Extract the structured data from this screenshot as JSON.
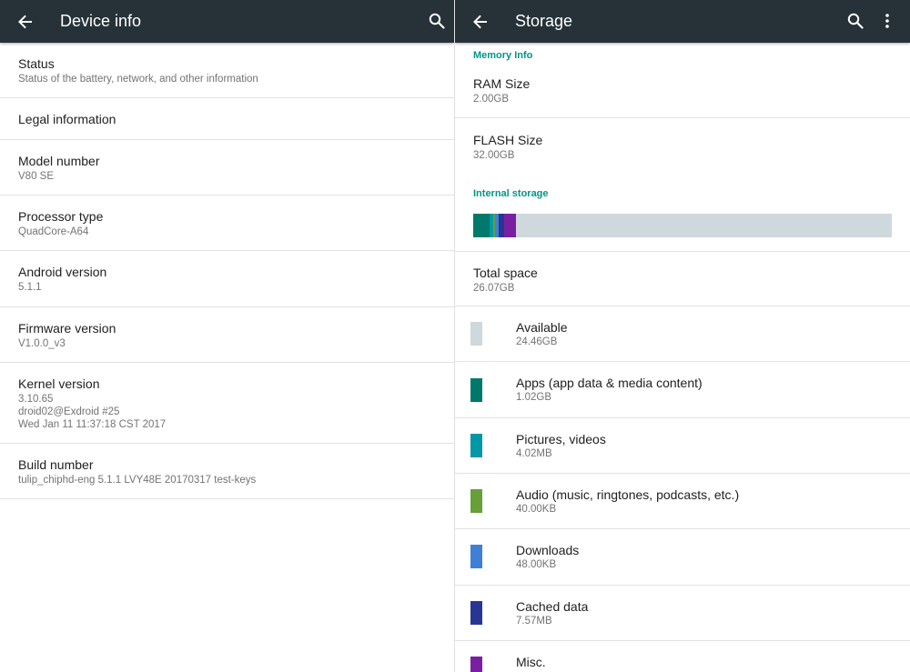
{
  "device_info": {
    "title": "Device info",
    "rows": [
      {
        "title": "Status",
        "subtitle": "Status of the battery, network, and other information"
      },
      {
        "title": "Legal information"
      },
      {
        "title": "Model number",
        "subtitle": "V80 SE"
      },
      {
        "title": "Processor type",
        "subtitle": "QuadCore-A64"
      },
      {
        "title": "Android version",
        "subtitle": "5.1.1"
      },
      {
        "title": "Firmware version",
        "subtitle": "V1.0.0_v3"
      },
      {
        "title": "Kernel version",
        "subtitle_lines": [
          "3.10.65",
          "droid02@Exdroid #25",
          "Wed Jan 11 11:37:18 CST 2017"
        ]
      },
      {
        "title": "Build number",
        "subtitle": "tulip_chiphd-eng 5.1.1 LVY48E 20170317 test-keys"
      }
    ]
  },
  "storage": {
    "title": "Storage",
    "memory_section": "Memory Info",
    "ram": {
      "title": "RAM Size",
      "value": "2.00GB"
    },
    "flash": {
      "title": "FLASH Size",
      "value": "32.00GB"
    },
    "internal_section": "Internal storage",
    "usage_bar": {
      "track_color": "#cfd8dc",
      "segments": [
        {
          "color": "#00796b",
          "fraction": 0.039
        },
        {
          "color": "#0097a7",
          "fraction": 0.008
        },
        {
          "color": "#689f38",
          "fraction": 0.006
        },
        {
          "color": "#3f7fd6",
          "fraction": 0.008
        },
        {
          "color": "#283593",
          "fraction": 0.013
        },
        {
          "color": "#7b1fa2",
          "fraction": 0.028
        }
      ]
    },
    "total": {
      "title": "Total space",
      "value": "26.07GB"
    },
    "items": [
      {
        "label": "Available",
        "value": "24.46GB",
        "color": "#cfd8dc"
      },
      {
        "label": "Apps (app data & media content)",
        "value": "1.02GB",
        "color": "#00796b"
      },
      {
        "label": "Pictures, videos",
        "value": "4.02MB",
        "color": "#0097a7"
      },
      {
        "label": "Audio (music, ringtones, podcasts, etc.)",
        "value": "40.00KB",
        "color": "#689f38"
      },
      {
        "label": "Downloads",
        "value": "48.00KB",
        "color": "#3f7fd6"
      },
      {
        "label": "Cached data",
        "value": "7.57MB",
        "color": "#283593"
      },
      {
        "label": "Misc.",
        "color": "#7b1fa2"
      }
    ]
  }
}
